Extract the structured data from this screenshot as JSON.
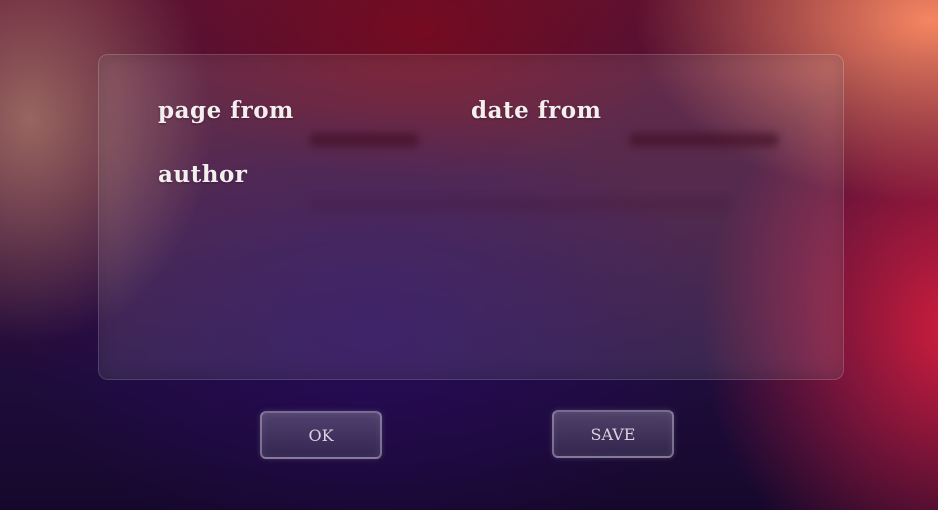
{
  "dialog": {
    "fields": {
      "page_from_label": "page from",
      "date_from_label": "date from",
      "author_label": "author"
    }
  },
  "buttons": {
    "ok_label": "OK",
    "save_label": "SAVE"
  }
}
